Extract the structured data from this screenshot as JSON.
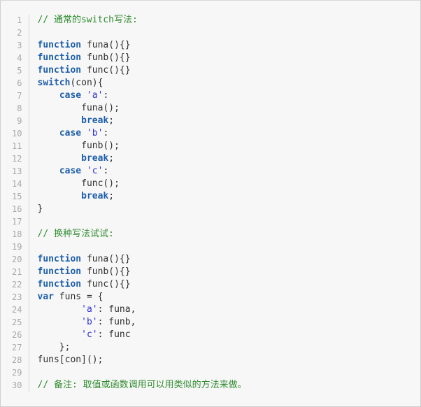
{
  "editor": {
    "language": "javascript",
    "background_color": "#f7f7f7",
    "border_color": "#d0d0d0",
    "gutter_divider_color": "#d9d9d9",
    "line_number_color": "#a9a9a9",
    "text_color": "#2f2f2f",
    "comment_color": "#2e8b2e",
    "keyword_color": "#1f5faa",
    "string_color": "#2b32d6",
    "first_line_number": 1,
    "last_line_number": 30,
    "total_lines": 30
  },
  "lines": [
    {
      "number": "1",
      "text": "// 通常的switch写法:",
      "tokens": [
        {
          "t": "// 通常的switch写法:",
          "k": "comment"
        }
      ]
    },
    {
      "number": "2",
      "text": "",
      "tokens": []
    },
    {
      "number": "3",
      "text": "function funa(){}",
      "tokens": [
        {
          "t": "function",
          "k": "keyword"
        },
        {
          "t": " funa(){}",
          "k": "plain"
        }
      ]
    },
    {
      "number": "4",
      "text": "function funb(){}",
      "tokens": [
        {
          "t": "function",
          "k": "keyword"
        },
        {
          "t": " funb(){}",
          "k": "plain"
        }
      ]
    },
    {
      "number": "5",
      "text": "function func(){}",
      "tokens": [
        {
          "t": "function",
          "k": "keyword"
        },
        {
          "t": " func(){}",
          "k": "plain"
        }
      ]
    },
    {
      "number": "6",
      "text": "switch(con){",
      "tokens": [
        {
          "t": "switch",
          "k": "keyword"
        },
        {
          "t": "(con){",
          "k": "plain"
        }
      ]
    },
    {
      "number": "7",
      "text": "    case 'a':",
      "tokens": [
        {
          "t": "    ",
          "k": "plain"
        },
        {
          "t": "case",
          "k": "keyword"
        },
        {
          "t": " ",
          "k": "plain"
        },
        {
          "t": "'a'",
          "k": "string"
        },
        {
          "t": ":",
          "k": "plain"
        }
      ]
    },
    {
      "number": "8",
      "text": "        funa();",
      "tokens": [
        {
          "t": "        funa();",
          "k": "plain"
        }
      ]
    },
    {
      "number": "9",
      "text": "        break;",
      "tokens": [
        {
          "t": "        ",
          "k": "plain"
        },
        {
          "t": "break",
          "k": "keyword"
        },
        {
          "t": ";",
          "k": "plain"
        }
      ]
    },
    {
      "number": "10",
      "text": "    case 'b':",
      "tokens": [
        {
          "t": "    ",
          "k": "plain"
        },
        {
          "t": "case",
          "k": "keyword"
        },
        {
          "t": " ",
          "k": "plain"
        },
        {
          "t": "'b'",
          "k": "string"
        },
        {
          "t": ":",
          "k": "plain"
        }
      ]
    },
    {
      "number": "11",
      "text": "        funb();",
      "tokens": [
        {
          "t": "        funb();",
          "k": "plain"
        }
      ]
    },
    {
      "number": "12",
      "text": "        break;",
      "tokens": [
        {
          "t": "        ",
          "k": "plain"
        },
        {
          "t": "break",
          "k": "keyword"
        },
        {
          "t": ";",
          "k": "plain"
        }
      ]
    },
    {
      "number": "13",
      "text": "    case 'c':",
      "tokens": [
        {
          "t": "    ",
          "k": "plain"
        },
        {
          "t": "case",
          "k": "keyword"
        },
        {
          "t": " ",
          "k": "plain"
        },
        {
          "t": "'c'",
          "k": "string"
        },
        {
          "t": ":",
          "k": "plain"
        }
      ]
    },
    {
      "number": "14",
      "text": "        func();",
      "tokens": [
        {
          "t": "        func();",
          "k": "plain"
        }
      ]
    },
    {
      "number": "15",
      "text": "        break;",
      "tokens": [
        {
          "t": "        ",
          "k": "plain"
        },
        {
          "t": "break",
          "k": "keyword"
        },
        {
          "t": ";",
          "k": "plain"
        }
      ]
    },
    {
      "number": "16",
      "text": "}",
      "tokens": [
        {
          "t": "}",
          "k": "plain"
        }
      ]
    },
    {
      "number": "17",
      "text": "",
      "tokens": []
    },
    {
      "number": "18",
      "text": "// 换种写法试试:",
      "tokens": [
        {
          "t": "// 换种写法试试:",
          "k": "comment"
        }
      ]
    },
    {
      "number": "19",
      "text": "",
      "tokens": []
    },
    {
      "number": "20",
      "text": "function funa(){}",
      "tokens": [
        {
          "t": "function",
          "k": "keyword"
        },
        {
          "t": " funa(){}",
          "k": "plain"
        }
      ]
    },
    {
      "number": "21",
      "text": "function funb(){}",
      "tokens": [
        {
          "t": "function",
          "k": "keyword"
        },
        {
          "t": " funb(){}",
          "k": "plain"
        }
      ]
    },
    {
      "number": "22",
      "text": "function func(){}",
      "tokens": [
        {
          "t": "function",
          "k": "keyword"
        },
        {
          "t": " func(){}",
          "k": "plain"
        }
      ]
    },
    {
      "number": "23",
      "text": "var funs = {",
      "tokens": [
        {
          "t": "var",
          "k": "keyword"
        },
        {
          "t": " funs = {",
          "k": "plain"
        }
      ]
    },
    {
      "number": "24",
      "text": "        'a': funa,",
      "tokens": [
        {
          "t": "        ",
          "k": "plain"
        },
        {
          "t": "'a'",
          "k": "string"
        },
        {
          "t": ": funa,",
          "k": "plain"
        }
      ]
    },
    {
      "number": "25",
      "text": "        'b': funb,",
      "tokens": [
        {
          "t": "        ",
          "k": "plain"
        },
        {
          "t": "'b'",
          "k": "string"
        },
        {
          "t": ": funb,",
          "k": "plain"
        }
      ]
    },
    {
      "number": "26",
      "text": "        'c': func",
      "tokens": [
        {
          "t": "        ",
          "k": "plain"
        },
        {
          "t": "'c'",
          "k": "string"
        },
        {
          "t": ": func",
          "k": "plain"
        }
      ]
    },
    {
      "number": "27",
      "text": "    };",
      "tokens": [
        {
          "t": "    };",
          "k": "plain"
        }
      ]
    },
    {
      "number": "28",
      "text": "funs[con]();",
      "tokens": [
        {
          "t": "funs[con]();",
          "k": "plain"
        }
      ]
    },
    {
      "number": "29",
      "text": "",
      "tokens": []
    },
    {
      "number": "30",
      "text": "// 备注: 取值或函数调用可以用类似的方法来做。",
      "tokens": [
        {
          "t": "// 备注: 取值或函数调用可以用类似的方法来做。",
          "k": "comment"
        }
      ]
    }
  ]
}
